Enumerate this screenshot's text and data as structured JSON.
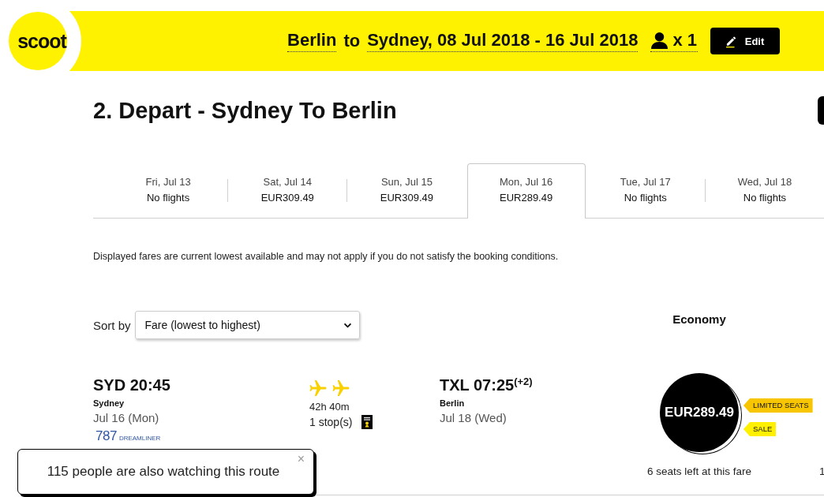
{
  "header": {
    "logo": "scoot",
    "origin": "Berlin",
    "connector": "to",
    "destination_dates": "Sydney, 08 Jul 2018 - 16 Jul 2018",
    "passengers": "x 1",
    "edit_button": "Edit"
  },
  "page_title": "2. Depart - Sydney To Berlin",
  "date_tabs": [
    {
      "day": "Fri, Jul 13",
      "fare": "No flights",
      "selected": false
    },
    {
      "day": "Sat, Jul 14",
      "fare": "EUR309.49",
      "selected": false
    },
    {
      "day": "Sun, Jul 15",
      "fare": "EUR309.49",
      "selected": false
    },
    {
      "day": "Mon, Jul 16",
      "fare": "EUR289.49",
      "selected": true
    },
    {
      "day": "Tue, Jul 17",
      "fare": "No flights",
      "selected": false
    },
    {
      "day": "Wed, Jul 18",
      "fare": "No flights",
      "selected": false
    }
  ],
  "disclaimer": "Displayed fares are current lowest available and may not apply if you do not satisfy the booking conditions.",
  "sort": {
    "label": "Sort by",
    "value": "Fare (lowest to highest)"
  },
  "fare_columns": [
    "Economy"
  ],
  "flights": [
    {
      "departure": {
        "time": "SYD 20:45",
        "city": "Sydney",
        "date": "Jul 16 (Mon)"
      },
      "aircraft": {
        "model": "787",
        "series": "DREAMLINER"
      },
      "duration": "42h 40m",
      "stops": "1 stop(s)",
      "arrival": {
        "time": "TXL 07:25$^{(+2)}$",
        "city": "Berlin",
        "date": "Jul 18 (Wed)"
      },
      "fares": [
        {
          "price": "EUR289.49",
          "tags": [
            {
              "label": "LIMITED SEATS",
              "color": "#f7c600"
            },
            {
              "label": "SALE",
              "color": "#fff000"
            }
          ],
          "seats_left": "6 seats left at this fare"
        },
        {
          "seats_left": "1"
        }
      ]
    }
  ],
  "toast": {
    "message": "115 people are also watching this route",
    "close": "×"
  }
}
